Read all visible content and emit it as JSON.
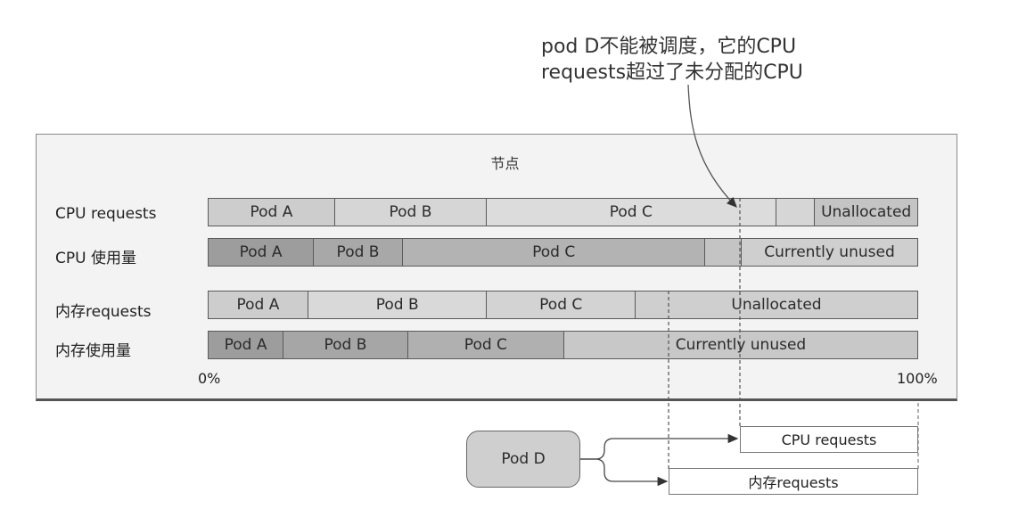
{
  "callout": {
    "line1": "pod D不能被调度，它的CPU",
    "line2": "requests超过了未分配的CPU"
  },
  "node": {
    "title": "节点",
    "scale_start": "0%",
    "scale_end": "100%",
    "rows": [
      {
        "label": "CPU requests",
        "segments": [
          {
            "label": "Pod A",
            "fraction": 0.178,
            "color": "#cdcdcd"
          },
          {
            "label": "Pod B",
            "fraction": 0.214,
            "color": "#d6d6d6"
          },
          {
            "label": "Pod C",
            "fraction": 0.409,
            "color": "#dcdcdc"
          },
          {
            "label": "",
            "fraction": 0.054,
            "color": "#d6d6d6"
          },
          {
            "label": "Unallocated",
            "fraction": 0.145,
            "color": "#c4c4c4"
          }
        ]
      },
      {
        "label": "CPU 使用量",
        "segments": [
          {
            "label": "Pod A",
            "fraction": 0.148,
            "color": "#9d9d9d"
          },
          {
            "label": "Pod B",
            "fraction": 0.125,
            "color": "#a8a8a8"
          },
          {
            "label": "Pod C",
            "fraction": 0.428,
            "color": "#b3b3b3"
          },
          {
            "label": "",
            "fraction": 0.05,
            "color": "#c4c4c4"
          },
          {
            "label": "Currently unused",
            "fraction": 0.249,
            "color": "#cfcfcf"
          }
        ]
      },
      {
        "label": "内存requests",
        "segments": [
          {
            "label": "Pod A",
            "fraction": 0.14,
            "color": "#cdcdcd"
          },
          {
            "label": "Pod B",
            "fraction": 0.252,
            "color": "#d9d9d9"
          },
          {
            "label": "Pod C",
            "fraction": 0.209,
            "color": "#d3d3d3"
          },
          {
            "label": "Unallocated",
            "fraction": 0.399,
            "color": "#cfcfcf"
          }
        ]
      },
      {
        "label": "内存使用量",
        "segments": [
          {
            "label": "Pod A",
            "fraction": 0.105,
            "color": "#9d9d9d"
          },
          {
            "label": "Pod B",
            "fraction": 0.175,
            "color": "#a6a6a6"
          },
          {
            "label": "Pod C",
            "fraction": 0.22,
            "color": "#b0b0b0"
          },
          {
            "label": "Currently unused",
            "fraction": 0.5,
            "color": "#c8c8c8"
          }
        ]
      }
    ]
  },
  "pod_d": {
    "label": "Pod D",
    "cpu_requests_label": "CPU requests",
    "memory_requests_label": "内存requests"
  }
}
